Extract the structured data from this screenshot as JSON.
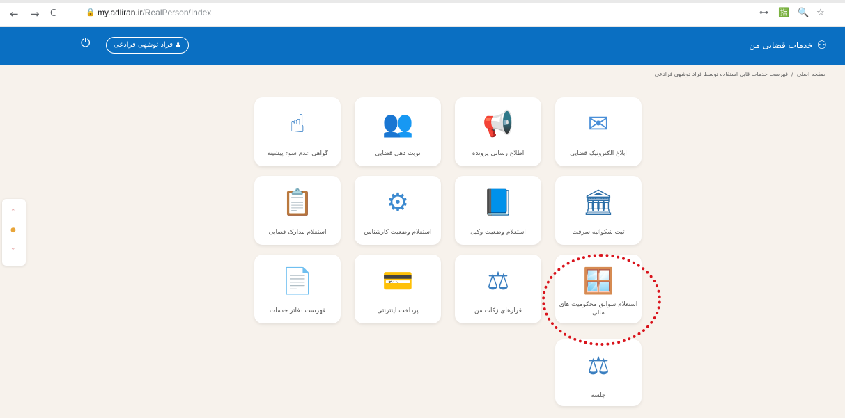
{
  "browser": {
    "back": "←",
    "forward": "→",
    "reload": "C",
    "lock": "🔒",
    "url_host": "my.adliran.ir",
    "url_path": "/RealPerson/Index",
    "key_icon": "⊶",
    "translate_icon": "🈯",
    "zoom_icon": "🔍",
    "star_icon": "☆"
  },
  "header": {
    "brand": "خدمات قضایی من",
    "user_button": "♟ فراد توشهی فرادعی",
    "power_icon": "⏻",
    "bg_color": "#0a6fc2"
  },
  "breadcrumb": {
    "home": "صفحه اصلی",
    "separator": "/",
    "current": "فهرست خدمات قابل استفاده توسط فراد توشهی فرادعی"
  },
  "cards": [
    {
      "label": "ابلاغ الکترونیک قضایی",
      "icon": "✉"
    },
    {
      "label": "اطلاع رسانی پرونده",
      "icon": "📢"
    },
    {
      "label": "نوبت دهی قضایی",
      "icon": "👥"
    },
    {
      "label": "گواهی عدم سوء پیشینه",
      "icon": "☝"
    },
    {
      "label": "ثبت شکوائیه سرقت",
      "icon": "🏛"
    },
    {
      "label": "استعلام وضعیت وکیل",
      "icon": "📘"
    },
    {
      "label": "استعلام وضعیت کارشناس",
      "icon": "⚙"
    },
    {
      "label": "استعلام مدارک قضایی",
      "icon": "📋"
    },
    {
      "label": "استعلام سوابق محکومیت های مالی",
      "icon": "🪟"
    },
    {
      "label": "قرارهای زکات من",
      "icon": "⚖"
    },
    {
      "label": "پرداخت اینترنتی",
      "icon": "💳"
    },
    {
      "label": "فهرست دفاتر خدمات",
      "icon": "📄"
    },
    {
      "label": "جلسه",
      "icon": "⚖"
    }
  ],
  "side_widget": {
    "up": "⌃",
    "drop": "●",
    "down": "⌄"
  },
  "colors": {
    "highlight": "#d9141c",
    "page_bg": "#f7f2ec"
  }
}
